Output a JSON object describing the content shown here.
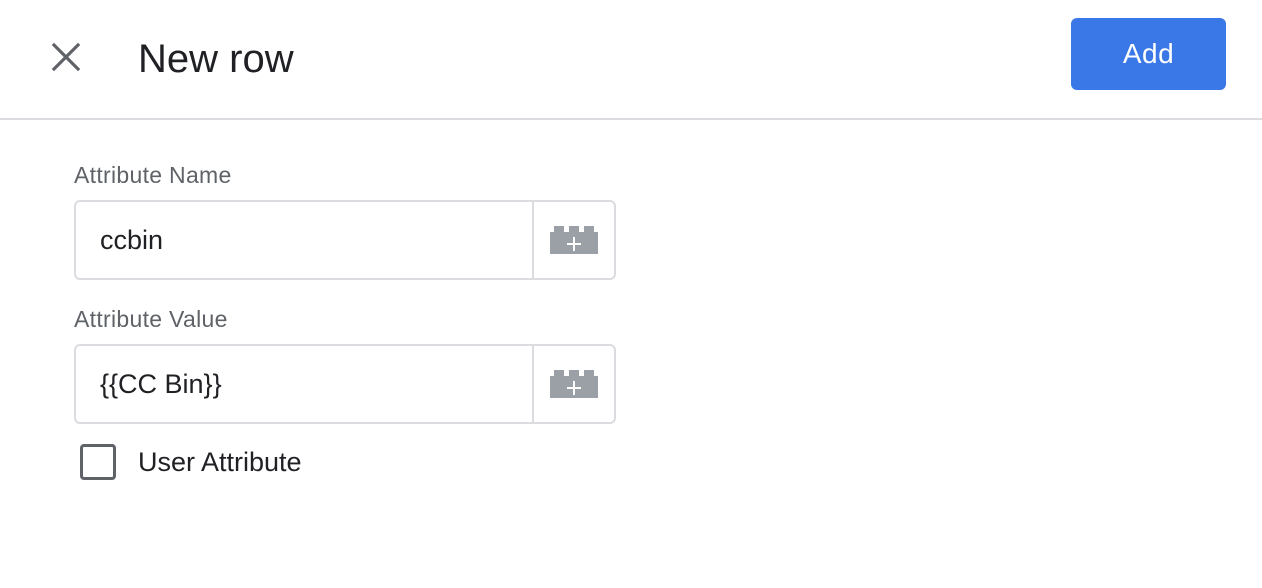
{
  "header": {
    "title": "New row",
    "add_label": "Add",
    "close_icon": "close-icon",
    "accent_color": "#3b78e7"
  },
  "form": {
    "attribute_name": {
      "label": "Attribute Name",
      "value": "ccbin",
      "variable_icon": "variable-picker-icon"
    },
    "attribute_value": {
      "label": "Attribute Value",
      "value": "{{CC Bin}}",
      "variable_icon": "variable-picker-icon"
    },
    "user_attribute": {
      "label": "User Attribute",
      "checked": false
    }
  }
}
